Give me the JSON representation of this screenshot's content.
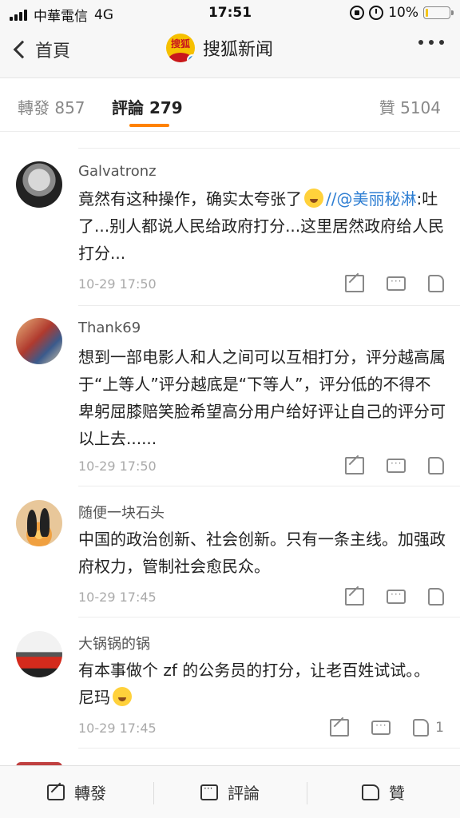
{
  "status_bar": {
    "carrier": "中華電信",
    "network": "4G",
    "time": "17:51",
    "battery": "10%",
    "battery_level": 0.1,
    "battery_color": "#f5c518"
  },
  "nav": {
    "back_label": "首頁",
    "title": "搜狐新闻",
    "logo_text": "搜狐",
    "more_icon": "more-dots-icon"
  },
  "tabs": {
    "repost_label": "轉發",
    "repost_count": "857",
    "comment_label": "評論",
    "comment_count": "279",
    "like_label": "贊",
    "like_count": "5104",
    "accent_color": "#ff8200"
  },
  "comments": [
    {
      "name": "Galvatronz",
      "text_before": "竟然有这种操作，确实太夸张了",
      "mention": "//@美丽秘淋",
      "text_after": ":吐了...别人都说人民给政府打分...这里居然政府给人民打分...",
      "date": "10-29 17:50",
      "likes": ""
    },
    {
      "name": "Thank69",
      "text": "想到一部电影人和人之间可以互相打分，评分越高属于“上等人”评分越底是“下等人”，评分低的不得不卑躬屈膝赔笑脸希望高分用户给好评让自己的评分可以上去......",
      "date": "10-29 17:50",
      "likes": ""
    },
    {
      "name": "随便一块石头",
      "text": "中国的政治创新、社会创新。只有一条主线。加强政府权力，管制社会愈民众。",
      "date": "10-29 17:45",
      "likes": ""
    },
    {
      "name": "大锅锅的锅",
      "text": "有本事做个 zf 的公务员的打分，让老百姓试试。。尼玛",
      "date": "10-29 17:45",
      "likes": "1"
    }
  ],
  "bottom_bar": {
    "repost": "轉發",
    "comment": "評論",
    "like": "贊"
  }
}
